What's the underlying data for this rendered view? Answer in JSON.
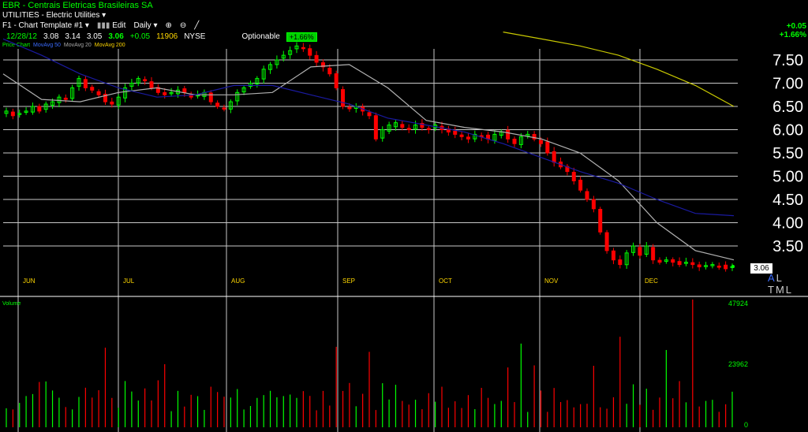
{
  "header": {
    "symbol": "EBR",
    "company": "Centrais Eletricas Brasileiras SA",
    "sector": "UTILITIES",
    "industry": "Electric Utilities",
    "toolbar": {
      "template": "F1 - Chart Template #1",
      "edit": "Edit",
      "period": "Daily"
    },
    "quote": {
      "date": "12/28/12",
      "open": "3.08",
      "high": "3.14",
      "low": "3.05",
      "close": "3.06",
      "change": "+0.05",
      "volume": "11906",
      "exchange": "NYSE",
      "optionable": "Optionable",
      "pct_badge": "+1.66%"
    },
    "legend": {
      "price_chart": "Price Chart",
      "ma50": "MovAvg 50",
      "ma20": "MovAvg 20",
      "ma200": "MovAvg 200"
    },
    "right_change": "+0.05",
    "right_pct": "+1.66%"
  },
  "colors": {
    "up": "#00ff00",
    "down": "#ff0000",
    "ma20": "#b0b0b0",
    "ma50": "#1a1aa0",
    "ma200": "#c8c800",
    "grid": "#c8c8c8"
  },
  "chart_data": {
    "type": "candlestick",
    "price_ticks": [
      "7.50",
      "7.00",
      "6.50",
      "6.00",
      "5.50",
      "5.00",
      "4.50",
      "4.00",
      "3.50"
    ],
    "month_labels": [
      "JUN",
      "JUL",
      "AUG",
      "SEP",
      "OCT",
      "NOV",
      "DEC"
    ],
    "last_price": "3.06",
    "volume_label": "Volume",
    "volume_ticks": [
      "47924",
      "23962",
      "0"
    ],
    "ohlc_close": [
      6.4,
      6.3,
      6.35,
      6.4,
      6.5,
      6.4,
      6.55,
      6.6,
      6.7,
      6.65,
      6.9,
      7.1,
      6.9,
      6.85,
      6.75,
      6.6,
      6.55,
      6.7,
      6.9,
      7.0,
      7.1,
      7.05,
      6.9,
      6.8,
      6.75,
      6.8,
      6.85,
      6.8,
      6.7,
      6.75,
      6.8,
      6.6,
      6.5,
      6.45,
      6.6,
      6.8,
      6.9,
      7.0,
      7.1,
      7.3,
      7.4,
      7.5,
      7.6,
      7.7,
      7.8,
      7.75,
      7.6,
      7.45,
      7.35,
      7.2,
      6.9,
      6.5,
      6.45,
      6.5,
      6.4,
      6.3,
      5.8,
      6.0,
      6.1,
      6.15,
      6.05,
      6.0,
      6.1,
      6.05,
      6.0,
      6.1,
      6.0,
      5.95,
      5.9,
      5.85,
      5.8,
      5.9,
      5.85,
      5.8,
      5.9,
      5.95,
      5.8,
      5.7,
      5.85,
      5.9,
      5.8,
      5.7,
      5.5,
      5.3,
      5.2,
      5.1,
      4.9,
      4.7,
      4.5,
      4.3,
      3.8,
      3.4,
      3.2,
      3.1,
      3.35,
      3.5,
      3.3,
      3.5,
      3.2,
      3.15,
      3.2,
      3.15,
      3.1,
      3.15,
      3.1,
      3.05,
      3.08,
      3.1,
      3.05,
      3.01,
      3.06
    ],
    "ma_sample_x": [
      0,
      1,
      2,
      3,
      4,
      5,
      6,
      7,
      8,
      9,
      10,
      11,
      12,
      13,
      14,
      15,
      16,
      17,
      18,
      19
    ],
    "ma20": [
      7.2,
      6.65,
      6.6,
      6.8,
      6.9,
      6.75,
      6.75,
      6.8,
      7.35,
      7.4,
      6.9,
      6.2,
      6.05,
      5.95,
      5.8,
      5.5,
      4.9,
      4.0,
      3.4,
      3.2
    ],
    "ma50": [
      7.95,
      7.6,
      7.2,
      6.9,
      6.7,
      6.75,
      6.95,
      6.95,
      6.75,
      6.55,
      6.25,
      6.1,
      5.95,
      5.7,
      5.4,
      5.1,
      4.85,
      4.5,
      4.2,
      4.15
    ],
    "ma200": [
      null,
      null,
      null,
      null,
      null,
      null,
      null,
      null,
      null,
      null,
      null,
      null,
      null,
      8.1,
      7.95,
      7.8,
      7.6,
      7.3,
      6.95,
      6.5
    ],
    "volume_max": 47924
  }
}
